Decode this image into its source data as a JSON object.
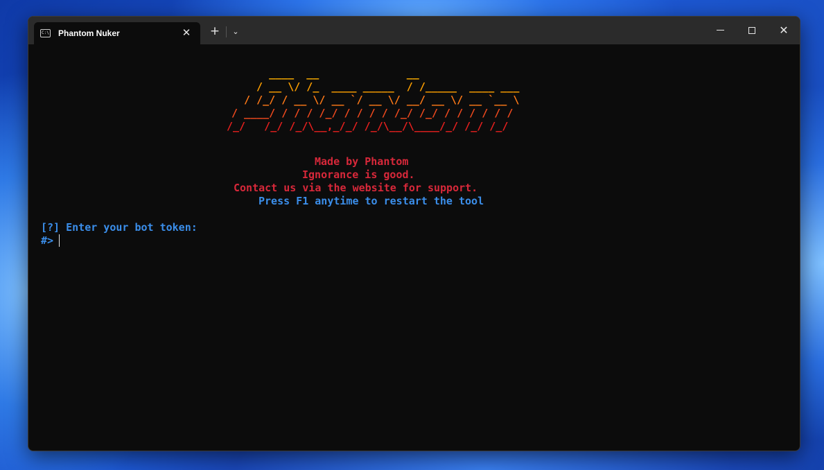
{
  "window": {
    "tab_title": "Phantom Nuker",
    "tab_icon": "terminal-icon",
    "new_tab": "+",
    "dropdown": "⌄",
    "close_tab": "✕",
    "minimize": "minimize-icon",
    "maximize": "maximize-icon",
    "close": "✕"
  },
  "colors": {
    "ascii_top": "#ffb000",
    "ascii_mid": "#ff7a18",
    "ascii_bottom": "#e8201e",
    "info_red": "#d8283a",
    "prompt_blue": "#3b8eea"
  },
  "terminal": {
    "ascii_art": [
      "   ____  __              __",
      "  / __ \\/ /_  ____ _____  / /_____  ____ ___",
      " / /_/ / __ \\/ __ `/ __ \\/ __/ __ \\/ __ `__ \\",
      "/ ____/ / / / /_/ / / / / /_/ /_/ / / / / / /",
      "/_/   /_/ /_/\\__,_/_/ /_/\\__/\\____/_/ /_/ /_/"
    ],
    "made_by": "Made by Phantom",
    "motto": "Ignorance is good.",
    "contact": "Contact us via the website for support.",
    "restart_hint": "Press F1 anytime to restart the tool",
    "question": "[?] Enter your bot token:",
    "prompt": "#>"
  }
}
